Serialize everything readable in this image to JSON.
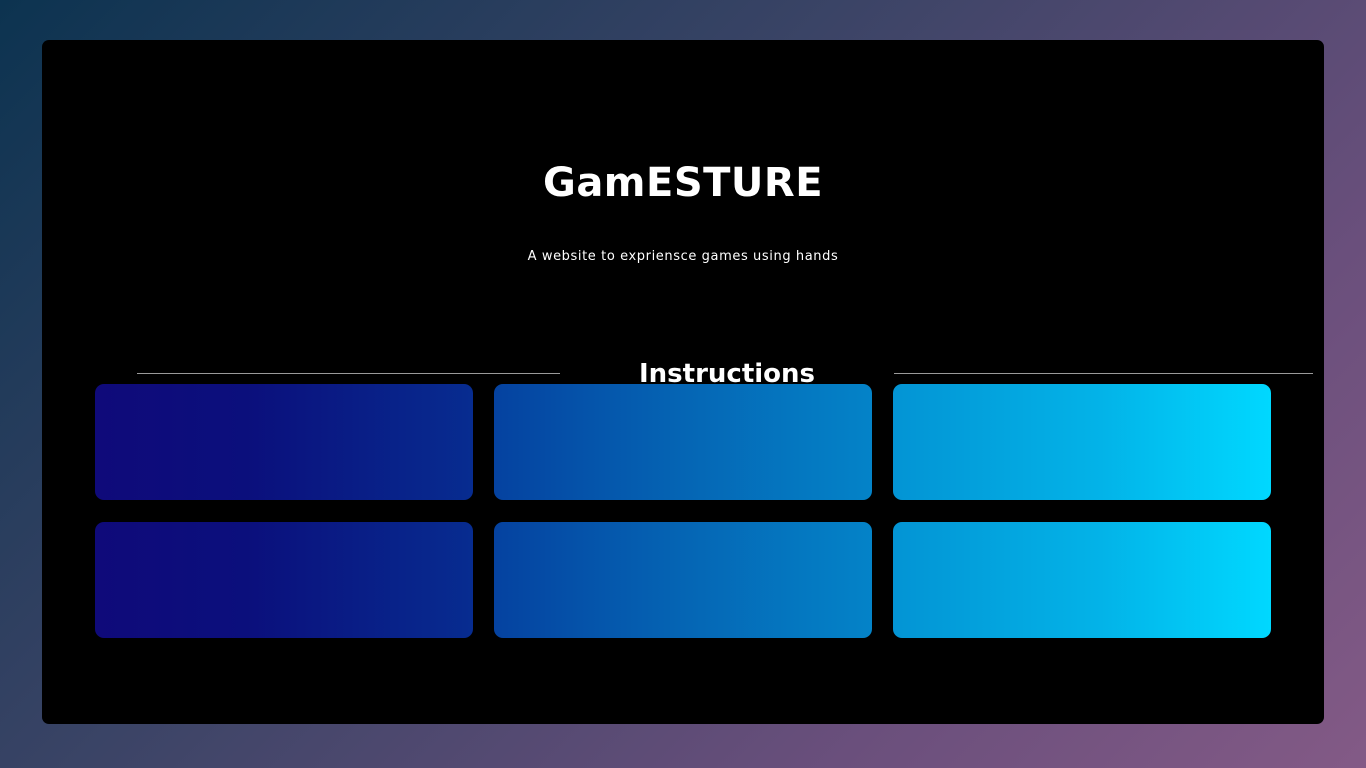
{
  "header": {
    "title": "GamESTURE",
    "subtitle": "A website to expriensce games using hands"
  },
  "instructions": {
    "heading": "Instructions",
    "cards": [
      {
        "row": 1,
        "col": 1
      },
      {
        "row": 1,
        "col": 2
      },
      {
        "row": 1,
        "col": 3
      },
      {
        "row": 2,
        "col": 1
      },
      {
        "row": 2,
        "col": 2
      },
      {
        "row": 2,
        "col": 3
      }
    ]
  },
  "colors": {
    "panel_background": "#000000",
    "text": "#ffffff",
    "divider": "#9a9a9a",
    "card_gradient_dark": "#0f0a7a",
    "card_gradient_mid": "#0565b4",
    "card_gradient_light": "#00d8ff"
  }
}
